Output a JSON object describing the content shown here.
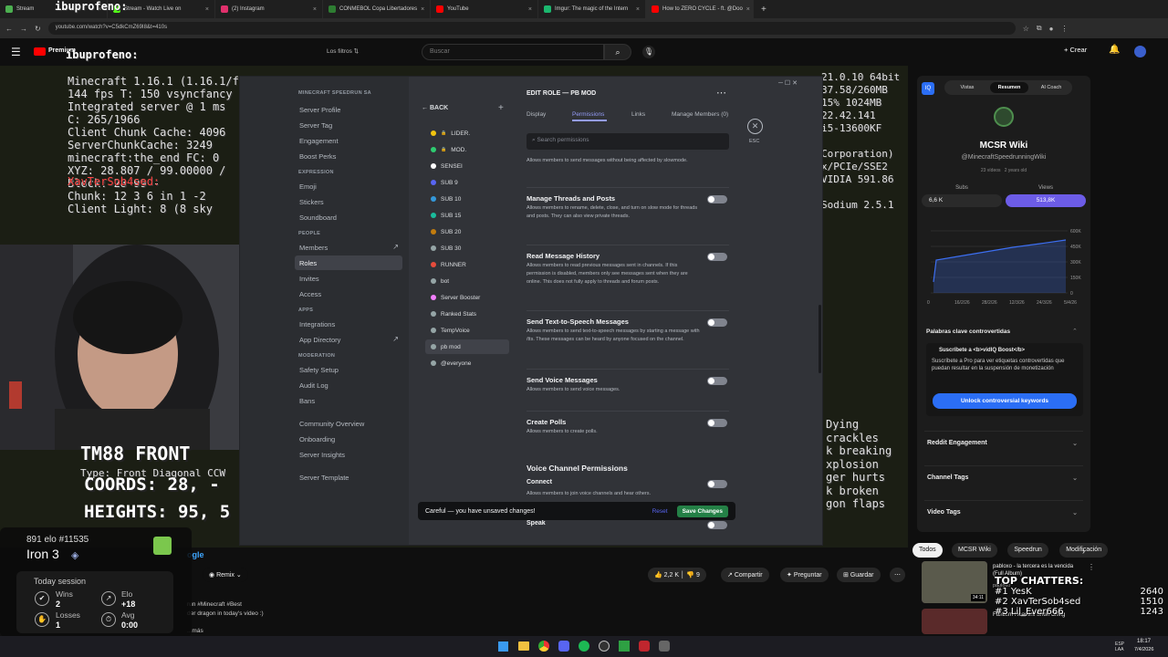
{
  "browser": {
    "tabs": [
      {
        "label": "Stream",
        "color": "#4caf50"
      },
      {
        "label": "Stream - Watch Live on",
        "color": "#53fc18"
      },
      {
        "label": "(2) Instagram",
        "color": "#e1306c"
      },
      {
        "label": "CONMEBOL Copa Libertadores",
        "color": "#2e7d32"
      },
      {
        "label": "YouTube",
        "color": "#ff0000"
      },
      {
        "label": "Imgur: The magic of the Intern",
        "color": "#1bb76e"
      },
      {
        "label": "How to ZERO CYCLE - ft. @Doo",
        "color": "#ff0000"
      }
    ],
    "url": "youtube.com/watch?v=C5dkCmZ69I8&t=410s"
  },
  "youtube": {
    "logo": "Premium",
    "filters_label": "Los filtros",
    "search_placeholder": "Buscar",
    "create_label": "Crear",
    "remix_label": "Remix",
    "likes": "2,2 K",
    "dislikes": "9",
    "share_label": "Compartir",
    "ask_label": "Preguntar",
    "save_label": "Guardar",
    "channel_link": "ogle",
    "desc_line1": "run #Minecraft #Best",
    "desc_line2": "der dragon in today's video :)",
    "desc_more": "...más",
    "chips": [
      "Todos",
      "MCSR Wiki",
      "Speedrun",
      "Modificación"
    ]
  },
  "overlay": {
    "chat_names": [
      "ibuprofeno:",
      "ibuprofeno:"
    ],
    "f3_lines": [
      "Minecraft 1.16.1 (1.16.1/fabric)",
      "144 fps T: 150 vsyncfancy",
      "Integrated server @ 1 ms",
      "C: 265/1966",
      "Client Chunk Cache: 4096",
      "ServerChunkCache: 3249",
      "minecraft:the_end FC: 0",
      "XYZ: 28.807 / 99.00000 /",
      "Block: 28 99 -",
      "Chunk: 12 3 6 in 1 -2",
      "Client Light: 8 (8 sky"
    ],
    "f3_right": [
      "21.0.10 64bit",
      "37.58/260MB",
      "15% 1024MB",
      "22.42.141",
      "i5-13600KF",
      "",
      "Corporation)",
      "x/PCIe/SSE2",
      "VIDIA 591.86",
      "",
      "Sodium 2.5.1"
    ],
    "sub_right": [
      "Dying",
      "crackles",
      "k breaking",
      "xplosion",
      "ger hurts",
      "k broken",
      "gon flaps"
    ],
    "red_name": "XavTerSob4sed:",
    "bottom_title": "TM88 FRONT",
    "bottom_type": "Type: Front Diagonal CCW",
    "coords": "COORDS: 28, -",
    "heights": "HEIGHTS: 95, 5"
  },
  "discord": {
    "server_name": "MINECRAFT SPEEDRUN SA",
    "sections": [
      {
        "heading": "",
        "items": [
          "Server Profile",
          "Server Tag",
          "Engagement",
          "Boost Perks"
        ]
      },
      {
        "heading": "EXPRESSION",
        "items": [
          "Emoji",
          "Stickers",
          "Soundboard"
        ]
      },
      {
        "heading": "PEOPLE",
        "items": [
          "Members",
          "Roles",
          "Invites",
          "Access"
        ]
      },
      {
        "heading": "APPS",
        "items": [
          "Integrations",
          "App Directory"
        ]
      },
      {
        "heading": "MODERATION",
        "items": [
          "Safety Setup",
          "Audit Log",
          "Bans"
        ]
      },
      {
        "heading": "",
        "items": [
          "Community Overview",
          "Onboarding",
          "Server Insights"
        ]
      },
      {
        "heading": "",
        "items": [
          "Server Template"
        ]
      }
    ],
    "back_label": "BACK",
    "roles": [
      {
        "name": "LIDER.",
        "color": "#f1c40f"
      },
      {
        "name": "MOD.",
        "color": "#2ecc71"
      },
      {
        "name": "SENSEI",
        "color": "#ffffff"
      },
      {
        "name": "SUB 9",
        "color": "#5865f2"
      },
      {
        "name": "SUB 10",
        "color": "#3498db"
      },
      {
        "name": "SUB 15",
        "color": "#1abc9c"
      },
      {
        "name": "SUB 20",
        "color": "#c27c0e"
      },
      {
        "name": "SUB 30",
        "color": "#95a5a6"
      },
      {
        "name": "RUNNER",
        "color": "#e74c3c"
      },
      {
        "name": "bot",
        "color": "#95a5a6"
      },
      {
        "name": "Server Booster",
        "color": "#f47fff"
      },
      {
        "name": "Ranked Stats",
        "color": "#95a5a6"
      },
      {
        "name": "TempVoice",
        "color": "#95a5a6"
      },
      {
        "name": "pb mod",
        "color": "#95a5a6"
      },
      {
        "name": "@everyone",
        "color": "#95a5a6"
      }
    ],
    "edit_title": "EDIT ROLE — PB MOD",
    "tabs": [
      "Display",
      "Permissions",
      "Links",
      "Manage Members (0)"
    ],
    "search_placeholder": "Search permissions",
    "esc_label": "ESC",
    "top_desc": "Allows members to send messages without being affected by slowmode.",
    "perms": [
      {
        "title": "Manage Threads and Posts",
        "desc": "Allows members to rename, delete, close, and turn on slow mode for threads and posts. They can also view private threads."
      },
      {
        "title": "Read Message History",
        "desc": "Allows members to read previous messages sent in channels. If this permission is disabled, members only see messages sent when they are online. This does not fully apply to threads and forum posts."
      },
      {
        "title": "Send Text-to-Speech Messages",
        "desc": "Allows members to send text-to-speech messages by starting a message with /tts. These messages can be heard by anyone focused on the channel."
      },
      {
        "title": "Send Voice Messages",
        "desc": "Allows members to send voice messages."
      },
      {
        "title": "Create Polls",
        "desc": "Allows members to create polls."
      }
    ],
    "voice_heading": "Voice Channel Permissions",
    "voice_perms": [
      {
        "title": "Connect",
        "desc": "Allows members to join voice channels and hear others."
      },
      {
        "title": "Speak",
        "desc": ""
      }
    ],
    "unsaved_text": "Careful — you have unsaved changes!",
    "reset_label": "Reset",
    "save_label": "Save Changes"
  },
  "vidiq": {
    "tabs": [
      "Vistas",
      "Resumen",
      "AI Coach"
    ],
    "channel": "MCSR Wiki",
    "handle": "@MinecraftSpeedrunningWiki",
    "meta1": "23 vídeos",
    "meta2": "2 years old",
    "subs_label": "Subs",
    "subs_value": "6,6 K",
    "views_label": "Views",
    "views_value": "513,8K",
    "chart_y": [
      "600K",
      "450K",
      "300K",
      "150K",
      "0"
    ],
    "chart_x": [
      "0",
      "16/2/26",
      "28/2/26",
      "12/3/26",
      "24/3/26",
      "5/4/26"
    ],
    "contro_heading": "Palabras clave controvertidas",
    "promo_title": "Suscríbete a <b>vidIQ Boost</b>",
    "promo_body": "Suscríbete a Pro para ver etiquetas controvertidas que puedan resultar en la suspensión de monetización",
    "unlock_label": "Unlock controversial keywords",
    "rows": [
      "Reddit Engagement",
      "Channel Tags",
      "Video Tags"
    ]
  },
  "stats": {
    "elo_line": "891 elo #11535",
    "rank": "Iron 3",
    "session_label": "Today session",
    "wins_label": "Wins",
    "wins": "2",
    "elo_label": "Elo",
    "elo": "+18",
    "losses_label": "Losses",
    "losses": "1",
    "avg_label": "Avg",
    "avg": "0:00"
  },
  "related": {
    "title": "pabloxo - la tercera es la vencida (Full Album)",
    "channel": "pabloxo",
    "duration": "34:11",
    "title2": "Fairbern Heavers Shun Ching"
  },
  "chatters": {
    "title": "TOP CHATTERS:",
    "list": [
      {
        "name": "#1 YesK",
        "count": "2640"
      },
      {
        "name": "#2 XavTerSob4sed",
        "count": "1510"
      },
      {
        "name": "#3 Lil_Ever666",
        "count": "1243"
      }
    ]
  },
  "taskbar": {
    "lang": "ESP LAA",
    "time": "18:17",
    "date": "7/4/2026"
  }
}
